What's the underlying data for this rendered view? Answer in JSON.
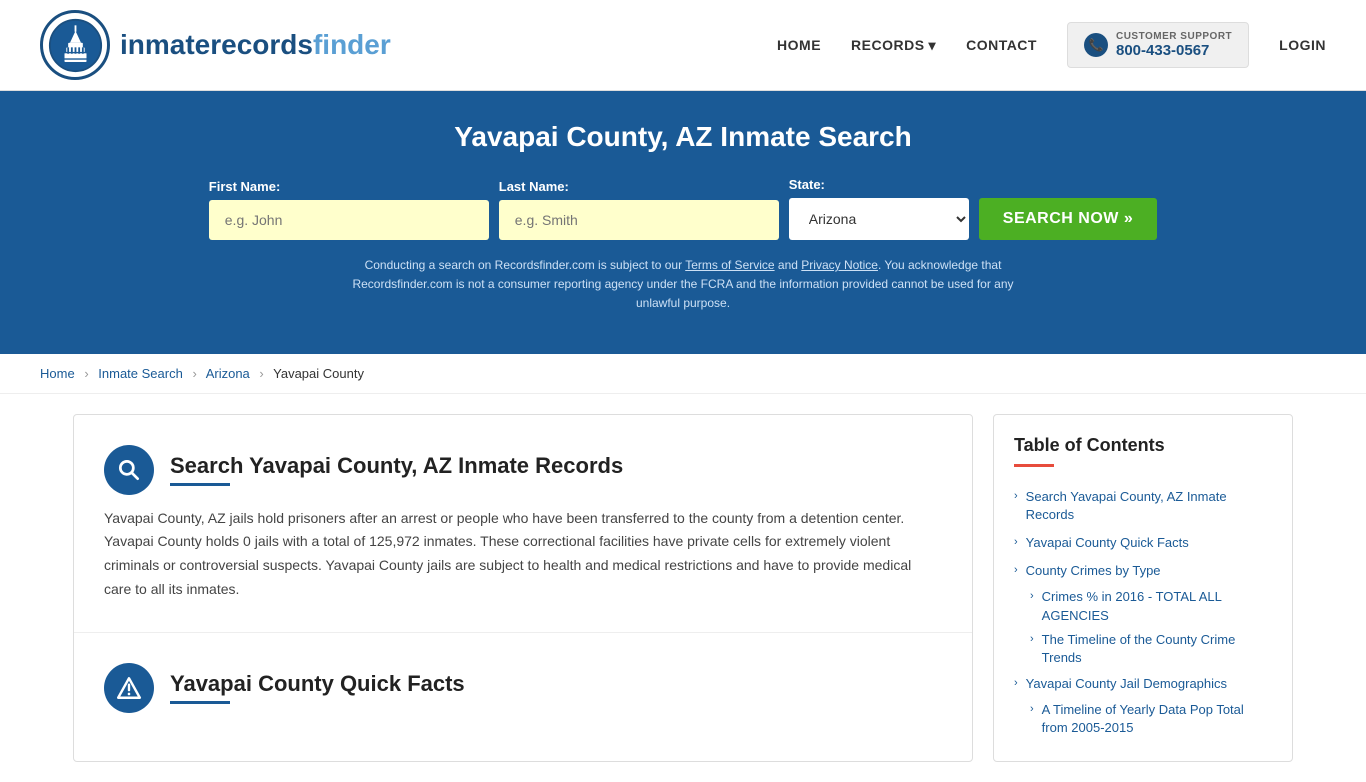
{
  "header": {
    "logo_text_main": "inmaterecords",
    "logo_text_accent": "finder",
    "nav": {
      "home": "HOME",
      "records": "RECORDS",
      "contact": "CONTACT",
      "login": "LOGIN"
    },
    "customer_support": {
      "label": "CUSTOMER SUPPORT",
      "phone": "800-433-0567"
    }
  },
  "hero": {
    "title": "Yavapai County, AZ Inmate Search",
    "first_name_label": "First Name:",
    "first_name_placeholder": "e.g. John",
    "last_name_label": "Last Name:",
    "last_name_placeholder": "e.g. Smith",
    "state_label": "State:",
    "state_value": "Arizona",
    "search_btn": "SEARCH NOW »",
    "disclaimer": "Conducting a search on Recordsfinder.com is subject to our Terms of Service and Privacy Notice. You acknowledge that Recordsfinder.com is not a consumer reporting agency under the FCRA and the information provided cannot be used for any unlawful purpose."
  },
  "breadcrumb": {
    "home": "Home",
    "inmate_search": "Inmate Search",
    "arizona": "Arizona",
    "current": "Yavapai County"
  },
  "sections": {
    "search": {
      "title": "Search Yavapai County, AZ Inmate Records",
      "body": "Yavapai County, AZ jails hold prisoners after an arrest or people who have been transferred to the county from a detention center. Yavapai County holds 0 jails with a total of 125,972 inmates. These correctional facilities have private cells for extremely violent criminals or controversial suspects. Yavapai County jails are subject to health and medical restrictions and have to provide medical care to all its inmates."
    },
    "quick_facts": {
      "title": "Yavapai County Quick Facts"
    }
  },
  "toc": {
    "title": "Table of Contents",
    "items": [
      {
        "label": "Search Yavapai County, AZ Inmate Records",
        "sub": false
      },
      {
        "label": "Yavapai County Quick Facts",
        "sub": false
      },
      {
        "label": "County Crimes by Type",
        "sub": false
      },
      {
        "label": "Crimes % in 2016 - TOTAL ALL AGENCIES",
        "sub": true
      },
      {
        "label": "The Timeline of the County Crime Trends",
        "sub": true
      },
      {
        "label": "Yavapai County Jail Demographics",
        "sub": false
      },
      {
        "label": "A Timeline of Yearly Data Pop Total from 2005-2015",
        "sub": true
      }
    ]
  }
}
